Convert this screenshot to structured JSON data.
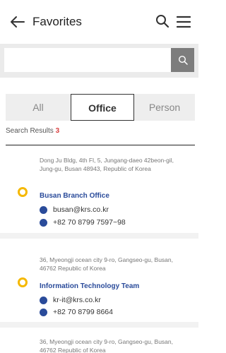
{
  "header": {
    "title": "Favorites"
  },
  "search": {
    "placeholder": "",
    "value": ""
  },
  "tabs": [
    {
      "label": "All",
      "selected": false
    },
    {
      "label": "Office",
      "selected": true
    },
    {
      "label": "Person",
      "selected": false
    }
  ],
  "results": {
    "label": "Search Results",
    "count": "3"
  },
  "entries": [
    {
      "address": "Dong Ju Bldg, 4th Fl, 5, Jungang-daeo 42beon-gil, Jung-gu, Busan 48943, Republic of Korea",
      "name": "Busan Branch Office",
      "email": "busan@krs.co.kr",
      "phone": "+82 70 8799 7597~98"
    },
    {
      "address": "36, Myeongji ocean city 9-ro, Gangseo-gu, Busan, 46762 Republic of Korea",
      "name": "Information Technology Team",
      "email": "kr-it@krs.co.kr",
      "phone": "+82 70 8799 8664"
    },
    {
      "address": "36, Myeongji ocean city 9-ro, Gangseo-gu, Busan, 46762 Republic of Korea"
    }
  ],
  "colors": {
    "accent": "#2a4b9a",
    "pin": "#f5b800",
    "count": "#d94040"
  }
}
